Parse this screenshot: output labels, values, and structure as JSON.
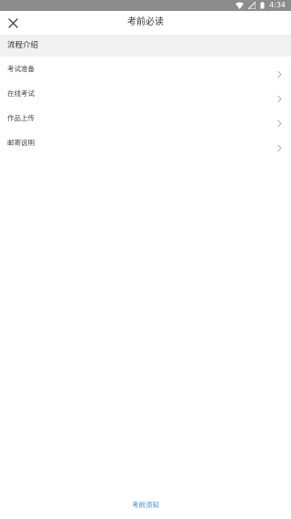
{
  "status_bar": {
    "time": "4:34"
  },
  "header": {
    "title": "考前必读"
  },
  "section": {
    "title": "流程介绍"
  },
  "items": [
    {
      "label": "考试准备"
    },
    {
      "label": "在线考试"
    },
    {
      "label": "作品上传"
    },
    {
      "label": "邮寄说明"
    }
  ],
  "footer": {
    "link": "考前须知"
  },
  "colors": {
    "accent": "#3d8fe0",
    "statusbar": "#8c8c8c",
    "section_bg": "#f1f1f1"
  }
}
